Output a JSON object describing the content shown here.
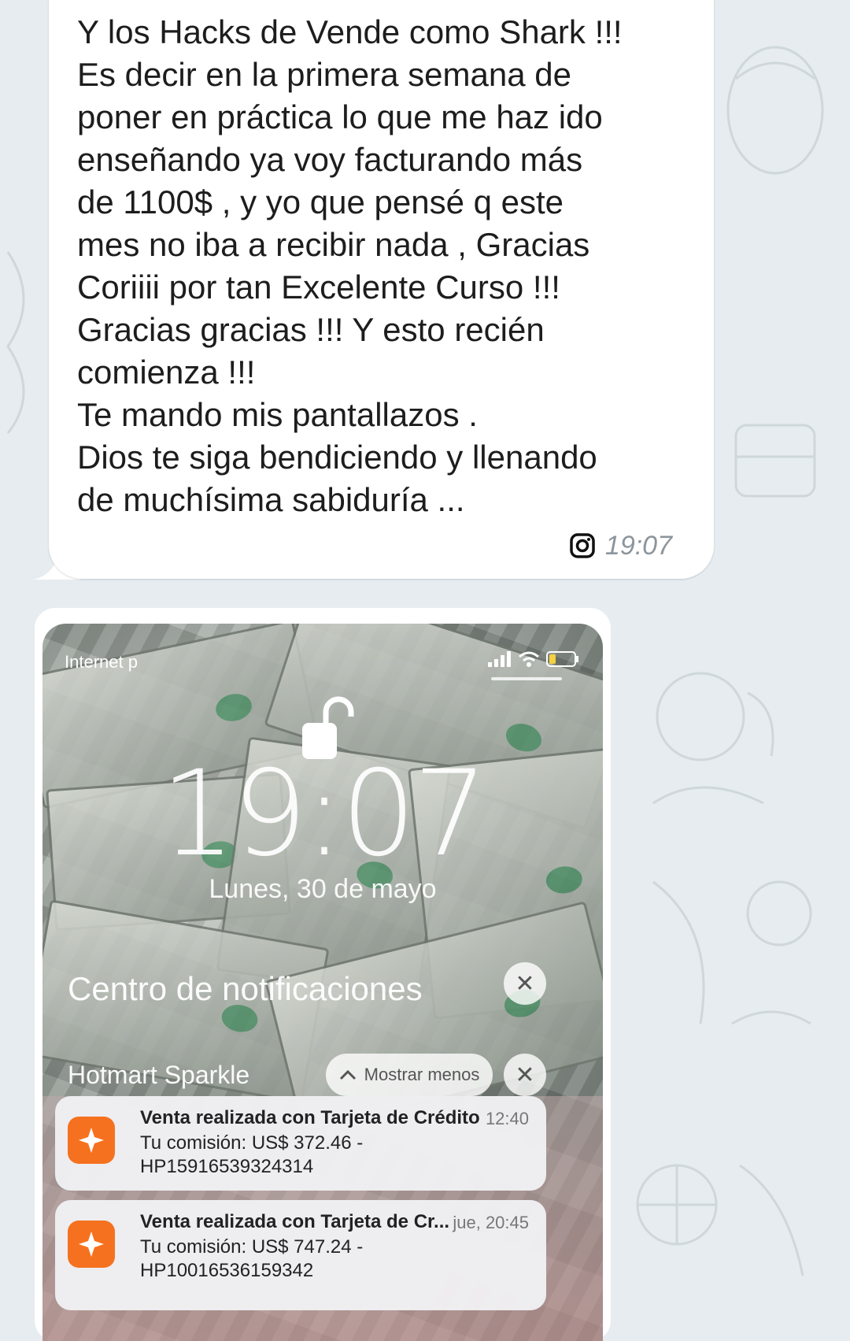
{
  "message": {
    "lines": [
      "Y los Hacks de Vende como Shark !!!",
      "Es decir en la primera semana de",
      "poner en práctica lo que me haz ido",
      "enseñando ya voy facturando más",
      "de 1100$ , y yo que pensé q este",
      "mes no iba a recibir nada , Gracias",
      "Coriiii por tan Excelente Curso !!!",
      "Gracias gracias !!! Y esto recién",
      "comienza !!!",
      "Te mando mis pantallazos .",
      "Dios te siga bendiciendo y llenando",
      "de muchísima sabiduría ..."
    ],
    "time": "19:07",
    "status_icon": "instagram-icon"
  },
  "screenshot": {
    "carrier": "Internet p",
    "clock": "19:07",
    "date": "Lunes, 30 de mayo",
    "notification_center_title": "Centro de notificaciones",
    "close_glyph": "✕",
    "app_group": "Hotmart Sparkle",
    "show_less_label": "Mostrar menos",
    "notifications": [
      {
        "title": "Venta realizada con Tarjeta de Crédito",
        "time": "12:40",
        "line1": "Tu comisión: US$ 372.46 -",
        "line2": "HP15916539324314"
      },
      {
        "title": "Venta realizada con Tarjeta de Cr...",
        "time": "jue, 20:45",
        "line1": "Tu comisión: US$ 747.24 -",
        "line2": "HP10016536159342"
      }
    ],
    "accent_color": "#f6711f"
  }
}
